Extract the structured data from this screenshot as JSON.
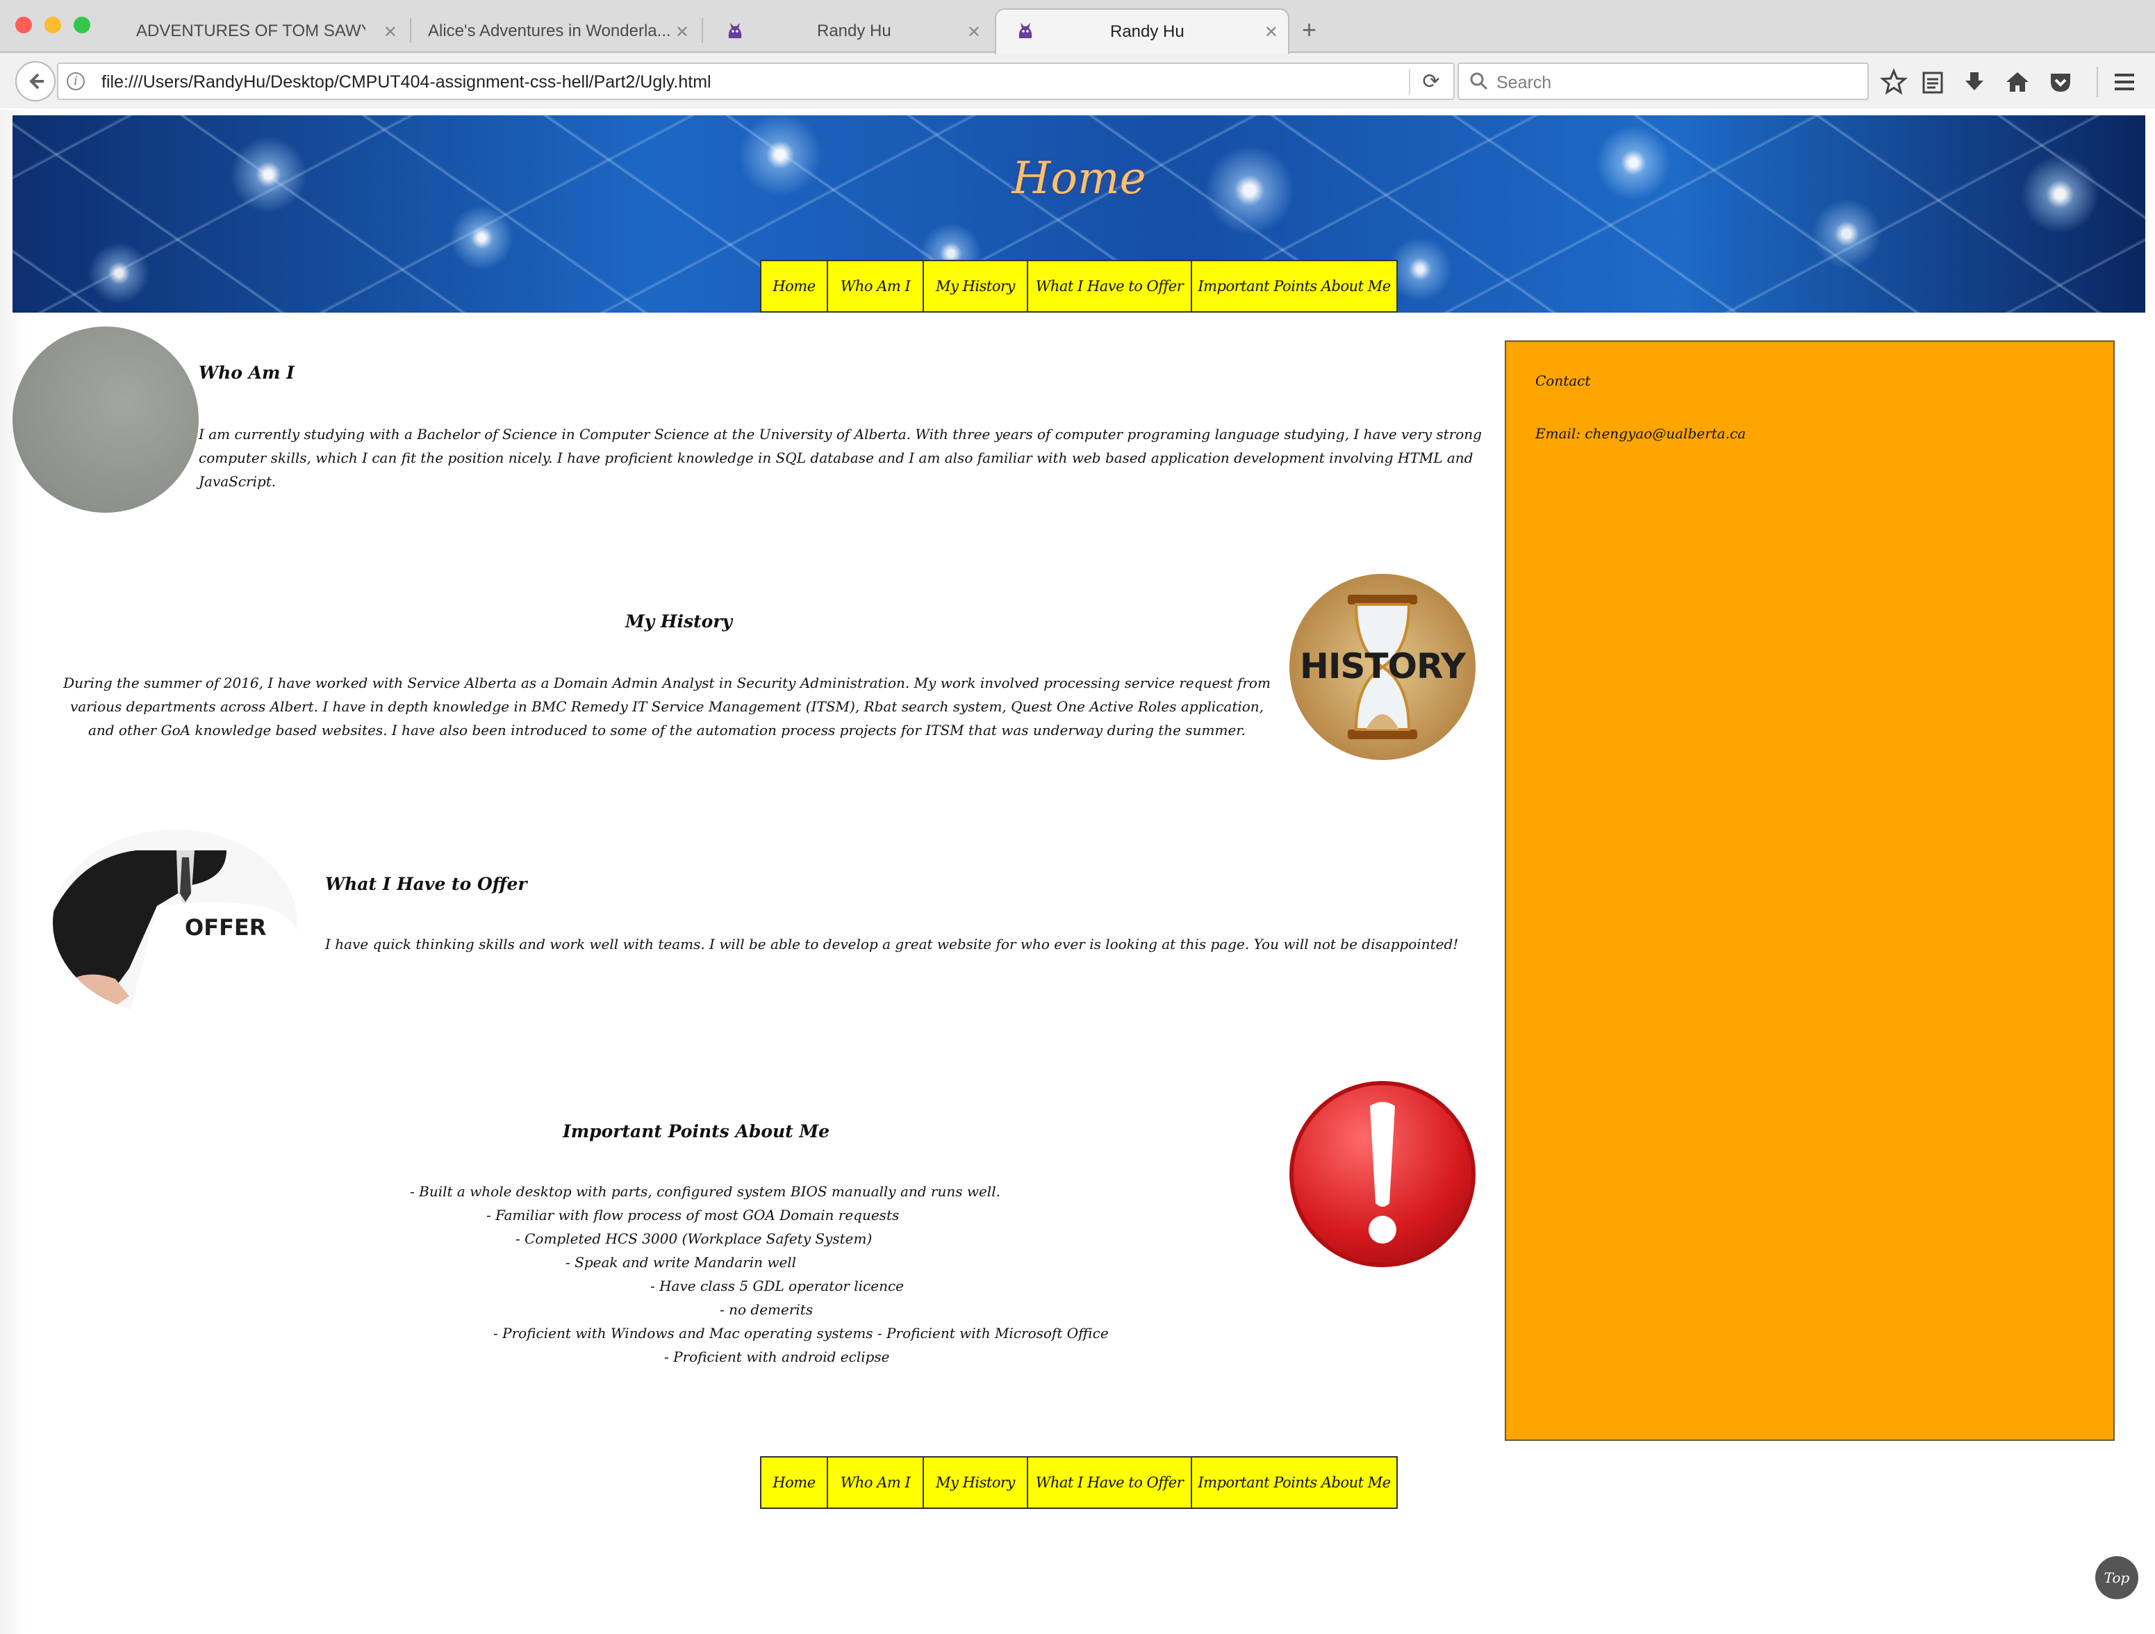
{
  "browser": {
    "tabs": [
      {
        "title": "ADVENTURES OF TOM SAWYE...",
        "active": false
      },
      {
        "title": "Alice's Adventures in Wonderla...",
        "active": false
      },
      {
        "title": "Randy Hu",
        "active": false
      },
      {
        "title": "Randy Hu",
        "active": true
      }
    ],
    "new_tab_label": "+",
    "url": "file:///Users/RandyHu/Desktop/CMPUT404-assignment-css-hell/Part2/Ugly.html",
    "search_placeholder": "Search",
    "toolbar_icons": [
      "back-icon",
      "info-icon",
      "reload-icon",
      "search-icon",
      "bookmark-star-icon",
      "reading-list-icon",
      "download-icon",
      "home-icon",
      "pocket-icon",
      "menu-icon"
    ]
  },
  "header": {
    "title": "Home"
  },
  "nav": {
    "items": [
      "Home",
      "Who Am I",
      "My History",
      "What I Have to Offer",
      "Important Points About Me"
    ]
  },
  "sections": {
    "who": {
      "title": "Who Am I",
      "text": "I am currently studying with a Bachelor of Science in Computer Science at the University of Alberta. With three years of computer programing language studying, I have very strong computer skills, which I can fit the position nicely. I have proficient knowledge in SQL database and I am also familiar with web based application development involving HTML and JavaScript."
    },
    "history": {
      "title": "My History",
      "text": "During the summer of 2016, I have worked with Service Alberta as a Domain Admin Analyst in Security Administration. My work involved processing service request from various departments across Albert. I have in depth knowledge in BMC Remedy IT Service Management (ITSM), Rbat search system, Quest One Active Roles application, and other GoA knowledge based websites. I have also been introduced to some of the automation process projects for ITSM that was underway during the summer.",
      "image_label": "HISTORY"
    },
    "offer": {
      "title": "What I Have to Offer",
      "text": "I have quick thinking skills and work well with teams. I will be able to develop a great website for who ever is looking at this page. You will not be disappointed!",
      "image_label": "OFFER"
    },
    "points": {
      "title": "Important Points About Me",
      "lines": [
        "- Built a whole desktop with parts, configured system BIOS manually and runs well.",
        "- Familiar with flow process of most GOA Domain requests",
        "- Completed HCS 3000 (Workplace Safety System)",
        "- Speak and write Mandarin well",
        "- Have class 5 GDL operator licence",
        "- no demerits",
        "- Proficient with Windows and Mac operating systems - Proficient with Microsoft Office",
        "- Proficient with android eclipse"
      ]
    }
  },
  "aside": {
    "heading": "Contact",
    "email": "Email: chengyao@ualberta.ca"
  },
  "top_button": "Top",
  "colors": {
    "nav_bg": "#ffff00",
    "aside_bg": "#ffa500",
    "header_title": "#f6c26c"
  }
}
